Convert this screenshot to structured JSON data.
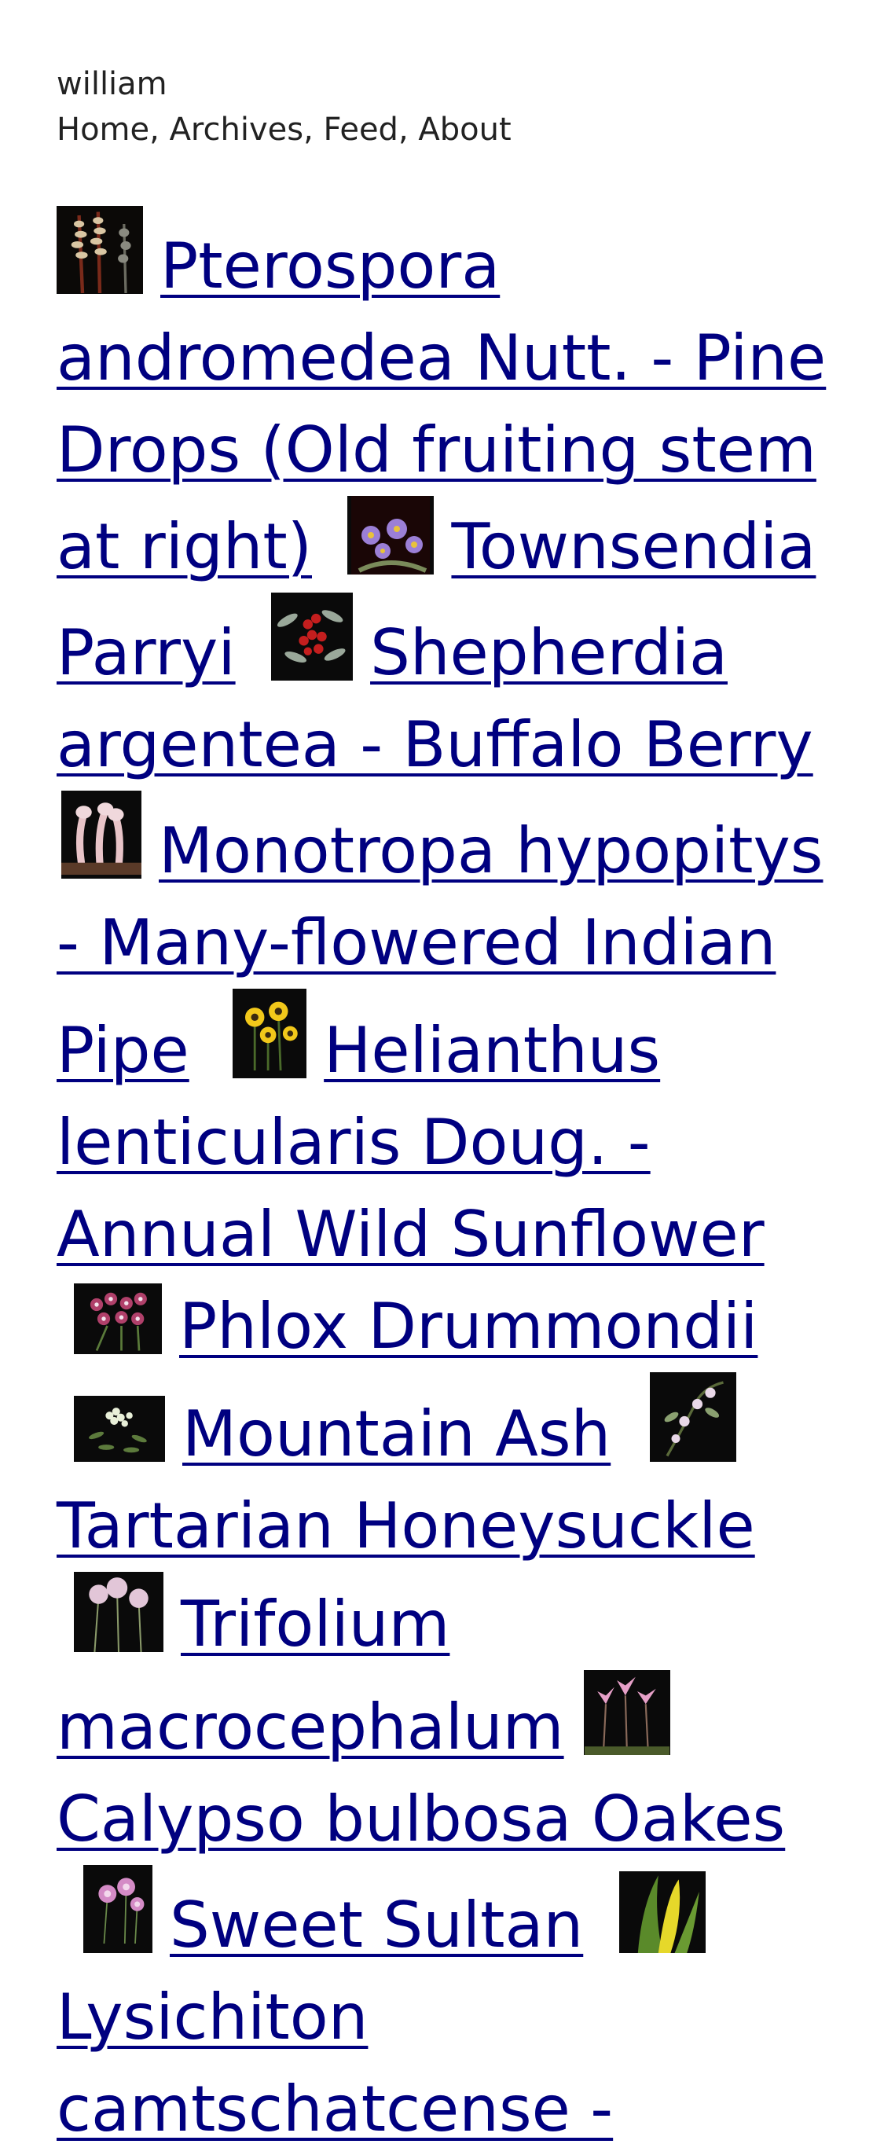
{
  "site": {
    "title": "william",
    "nav": [
      {
        "label": "Home"
      },
      {
        "label": "Archives"
      },
      {
        "label": "Feed"
      },
      {
        "label": "About"
      }
    ],
    "nav_separator": ", "
  },
  "entries": [
    {
      "title": "Pterospora andromedea Nutt. - Pine Drops (Old fruiting stem at right)",
      "thumb_icon": "pine-drops-thumbnail-icon"
    },
    {
      "title": "Townsendia Parryi",
      "thumb_icon": "townsendia-thumbnail-icon"
    },
    {
      "title": "Shepherdia argentea - Buffalo Berry",
      "thumb_icon": "buffalo-berry-thumbnail-icon"
    },
    {
      "title": "Monotropa hypopitys - Many-flowered Indian Pipe",
      "thumb_icon": "indian-pipe-thumbnail-icon"
    },
    {
      "title": "Helianthus lenticularis Doug. - Annual Wild Sunflower",
      "thumb_icon": "sunflower-thumbnail-icon"
    },
    {
      "title": "Phlox Drummondii",
      "thumb_icon": "phlox-thumbnail-icon"
    },
    {
      "title": "Mountain Ash",
      "thumb_icon": "mountain-ash-thumbnail-icon"
    },
    {
      "title": "Tartarian Honeysuckle",
      "thumb_icon": "honeysuckle-thumbnail-icon"
    },
    {
      "title": "Trifolium macrocephalum",
      "thumb_icon": "trifolium-thumbnail-icon"
    },
    {
      "title": "Calypso bulbosa Oakes",
      "thumb_icon": "calypso-thumbnail-icon"
    },
    {
      "title": "Sweet Sultan",
      "thumb_icon": "sweet-sultan-thumbnail-icon"
    },
    {
      "title": "Lysichiton camtschatcense -",
      "thumb_icon": "lysichiton-thumbnail-icon"
    }
  ],
  "colors": {
    "link": "#000080",
    "text": "#222222",
    "background": "#ffffff",
    "thumb_background": "#0a0a0a"
  }
}
